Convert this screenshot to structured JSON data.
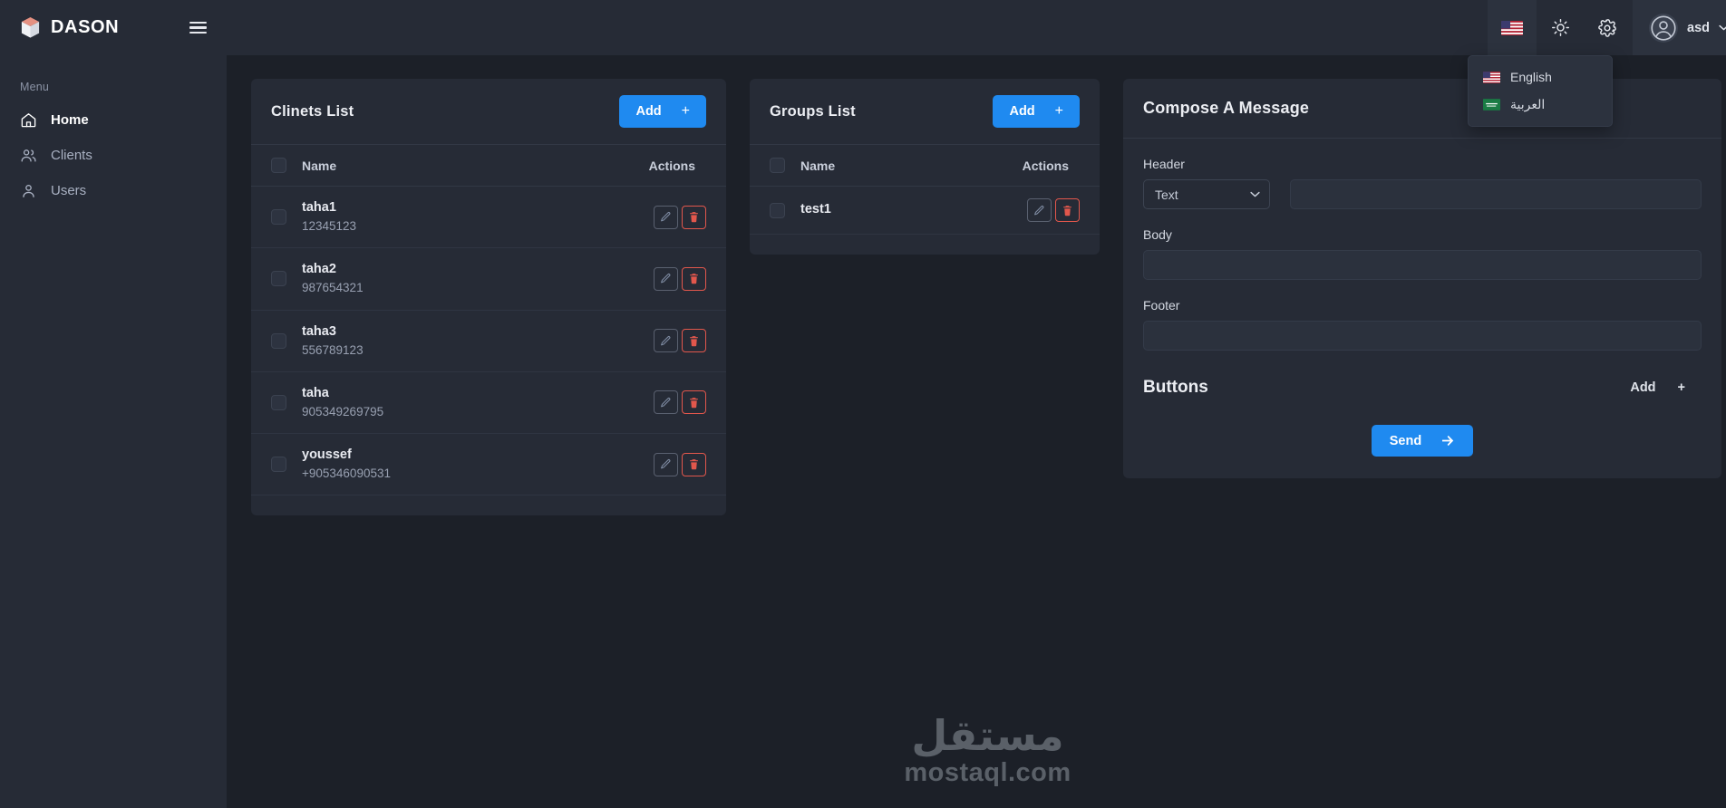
{
  "brand": {
    "name": "DASON",
    "logo_icon": "cube-icon",
    "menu_toggle_icon": "hamburger-icon"
  },
  "sidebar": {
    "section_label": "Menu",
    "items": [
      {
        "label": "Home",
        "icon": "home-icon",
        "active": true
      },
      {
        "label": "Clients",
        "icon": "users-group-icon",
        "active": false
      },
      {
        "label": "Users",
        "icon": "user-icon",
        "active": false
      }
    ]
  },
  "topbar": {
    "language_icon": "flag-us-icon",
    "theme_icon": "sun-icon",
    "settings_icon": "gear-icon",
    "avatar_icon": "user-circle-icon",
    "profile_name": "asd",
    "caret_icon": "chevron-down-icon"
  },
  "language_menu": {
    "open": true,
    "items": [
      {
        "label": "English",
        "flag": "flag-us-icon"
      },
      {
        "label": "العربية",
        "flag": "flag-sa-icon"
      }
    ]
  },
  "clients_card": {
    "title": "Clinets List",
    "add_label": "Add",
    "add_plus": "+",
    "columns": {
      "name": "Name",
      "actions": "Actions"
    },
    "rows": [
      {
        "name": "taha1",
        "phone": "12345123"
      },
      {
        "name": "taha2",
        "phone": "987654321"
      },
      {
        "name": "taha3",
        "phone": "556789123"
      },
      {
        "name": "taha",
        "phone": "905349269795"
      },
      {
        "name": "youssef",
        "phone": "+905346090531"
      }
    ],
    "edit_icon": "pencil-icon",
    "delete_icon": "trash-icon"
  },
  "groups_card": {
    "title": "Groups List",
    "add_label": "Add",
    "add_plus": "+",
    "columns": {
      "name": "Name",
      "actions": "Actions"
    },
    "rows": [
      {
        "name": "test1"
      }
    ],
    "edit_icon": "pencil-icon",
    "delete_icon": "trash-icon"
  },
  "compose_card": {
    "title": "Compose A Message",
    "header_label": "Header",
    "header_type_value": "Text",
    "header_type_options": [
      "Text"
    ],
    "header_text_value": "",
    "body_label": "Body",
    "body_value": "",
    "footer_label": "Footer",
    "footer_value": "",
    "buttons_title": "Buttons",
    "buttons_add_label": "Add",
    "buttons_add_plus": "+",
    "send_label": "Send",
    "send_icon": "send-arrow-icon"
  },
  "watermark": {
    "arabic": "مستقل",
    "latin": "mostaql.com"
  },
  "colors": {
    "page_bg": "#1c2028",
    "panel_bg": "#262b36",
    "accent_blue": "#1f8af0",
    "danger_red": "#e2574c",
    "logo_salmon": "#e08070"
  }
}
